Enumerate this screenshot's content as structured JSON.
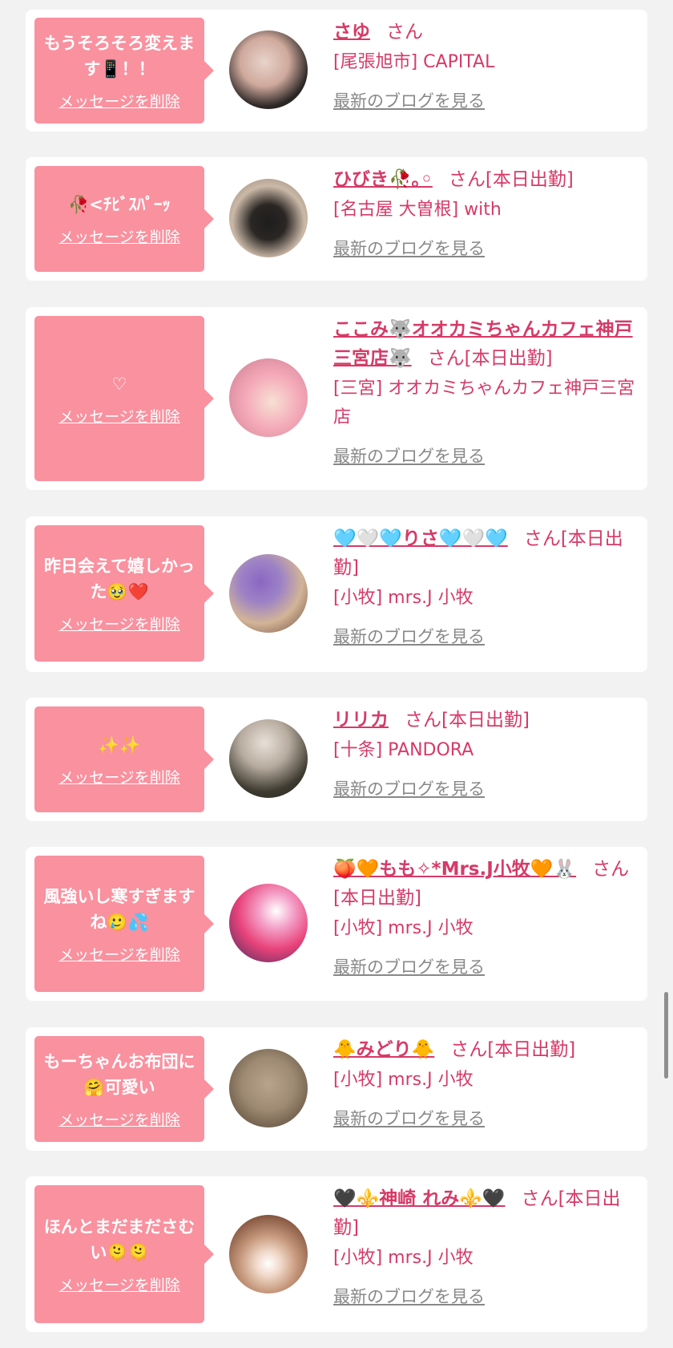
{
  "cards": [
    {
      "message": "もうそろそろ変えます📱！！",
      "delete_label": "メッセージを削除",
      "name": "さゆ",
      "suffix": "さん",
      "shop": "[尾張旭市] CAPITAL",
      "blog_label": "最新のブログを見る",
      "avatar_colors": [
        "#2c2726",
        "#e8d3cb"
      ]
    },
    {
      "message": "🥀<ﾁﾋﾞｽﾊﾟｰｯ",
      "delete_label": "メッセージを削除",
      "name": "ひびき🥀｡◦",
      "suffix": "さん[本日出勤]",
      "shop": "[名古屋 大曽根] with",
      "blog_label": "最新のブログを見る",
      "avatar_colors": [
        "#cbb9a8",
        "#1e1e1e"
      ]
    },
    {
      "message": "♡",
      "delete_label": "メッセージを削除",
      "name": "ここみ🐺オオカミちゃんカフェ神戸三宮店🐺",
      "suffix": "さん[本日出勤]",
      "shop": "[三宮] オオカミちゃんカフェ神戸三宮店",
      "blog_label": "最新のブログを見る",
      "avatar_colors": [
        "#f4a9b8",
        "#c97a8e"
      ]
    },
    {
      "message": "昨日会えて嬉しかった🥹❤️",
      "delete_label": "メッセージを削除",
      "name": "🩵🤍🩵りさ🩵🤍🩵",
      "suffix": "さん[本日出勤]",
      "shop": "[小牧] mrs.J 小牧",
      "blog_label": "最新のブログを見る",
      "avatar_colors": [
        "#8a67c2",
        "#d2b497"
      ]
    },
    {
      "message": "✨✨",
      "delete_label": "メッセージを削除",
      "name": "リリカ",
      "suffix": "さん[本日出勤]",
      "shop": "[十条] PANDORA",
      "blog_label": "最新のブログを見る",
      "avatar_colors": [
        "#3d3a30",
        "#e8e0d8"
      ]
    },
    {
      "message": "風強いし寒すぎますね🥲💦",
      "delete_label": "メッセージを削除",
      "name": "🍑🧡もも✧*Mrs.J小牧🧡🐰",
      "suffix": "さん[本日出勤]",
      "shop": "[小牧] mrs.J 小牧",
      "blog_label": "最新のブログを見る",
      "avatar_colors": [
        "#e8437a",
        "#3b2a5c"
      ]
    },
    {
      "message": "もーちゃんお布団に🤗可愛い",
      "delete_label": "メッセージを削除",
      "name": "🐥みどり🐥",
      "suffix": "さん[本日出勤]",
      "shop": "[小牧] mrs.J 小牧",
      "blog_label": "最新のブログを見る",
      "avatar_colors": [
        "#9e8a72",
        "#6b5a48"
      ]
    },
    {
      "message": "ほんとまだまださむい🫠🫠",
      "delete_label": "メッセージを削除",
      "name": "🖤⚜️神崎 れみ⚜️🖤",
      "suffix": "さん[本日出勤]",
      "shop": "[小牧] mrs.J 小牧",
      "blog_label": "最新のブログを見る",
      "avatar_colors": [
        "#8a5a44",
        "#f0d8c8"
      ]
    }
  ]
}
